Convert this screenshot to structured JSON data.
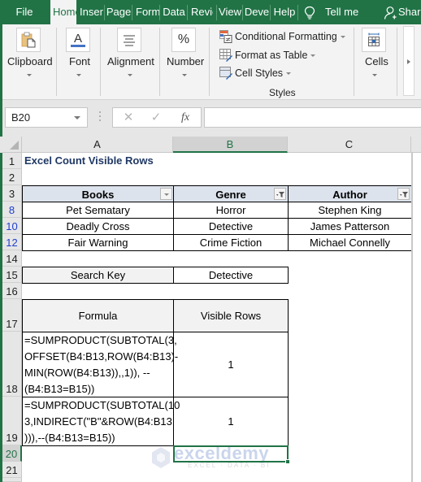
{
  "tabs": [
    {
      "label": "File",
      "active": false
    },
    {
      "label": "Home",
      "active": true
    },
    {
      "label": "Insert",
      "active": false
    },
    {
      "label": "Page",
      "active": false
    },
    {
      "label": "Form",
      "active": false
    },
    {
      "label": "Data",
      "active": false
    },
    {
      "label": "Revie",
      "active": false
    },
    {
      "label": "View",
      "active": false
    },
    {
      "label": "Deve",
      "active": false
    },
    {
      "label": "Help",
      "active": false
    }
  ],
  "tell_me": {
    "icon": "lightbulb-icon",
    "label": "Tell me"
  },
  "share": {
    "icon": "person-add-icon",
    "label": "Share"
  },
  "ribbon": {
    "groups": [
      {
        "label": "Clipboard",
        "icon": "clipboard-icon"
      },
      {
        "label": "Font",
        "icon": "font-icon"
      },
      {
        "label": "Alignment",
        "icon": "alignment-icon"
      },
      {
        "label": "Number",
        "icon": "percent-icon",
        "icon_text": "%"
      },
      {
        "label": "Cells",
        "icon": "cells-icon"
      }
    ],
    "styles": {
      "items": [
        {
          "label": "Conditional Formatting",
          "icon": "conditional-formatting-icon"
        },
        {
          "label": "Format as Table",
          "icon": "format-table-icon"
        },
        {
          "label": "Cell Styles",
          "icon": "cell-styles-icon"
        }
      ],
      "group_label": "Styles"
    },
    "font_letter": "A",
    "accent_underline_color": "#4472c4"
  },
  "formula_bar": {
    "name_box": "B20",
    "cancel_symbol": "✕",
    "enter_symbol": "✓",
    "fx_label": "fx",
    "value": ""
  },
  "columns": [
    "A",
    "B",
    "C"
  ],
  "selected_column": "B",
  "rows": [
    {
      "num": "1"
    },
    {
      "num": "2"
    },
    {
      "num": "3"
    },
    {
      "num": "8",
      "filtered": true
    },
    {
      "num": "10",
      "filtered": true
    },
    {
      "num": "12",
      "filtered": true
    },
    {
      "num": "14"
    },
    {
      "num": "15"
    },
    {
      "num": "16"
    },
    {
      "num": "17"
    },
    {
      "num": "18"
    },
    {
      "num": "19"
    },
    {
      "num": "20",
      "selected": true
    },
    {
      "num": "21"
    }
  ],
  "sheet": {
    "title": "Excel Count Visible Rows",
    "table": {
      "headers": [
        "Books",
        "Genre",
        "Author"
      ],
      "filter_state": [
        "dropdown",
        "filtered",
        "filtered"
      ],
      "rows": [
        [
          "Pet Sematary",
          "Horror",
          "Stephen King"
        ],
        [
          "Deadly Cross",
          "Detective",
          "James Patterson"
        ],
        [
          "Fair Warning",
          "Crime Fiction",
          "Michael Connelly"
        ]
      ]
    },
    "search_key": {
      "label": "Search Key",
      "value": "Detective"
    },
    "results": {
      "headers": [
        "Formula",
        "Visible Rows"
      ],
      "rows": [
        {
          "formula": "=SUMPRODUCT(SUBTOTAL(3,\nOFFSET(B4:B13,ROW(B4:B13)-\nMIN(ROW(B4:B13)),,1)), --\n(B4:B13=B15))",
          "value": "1"
        },
        {
          "formula": "=SUMPRODUCT(SUBTOTAL(10\n3,INDIRECT(\"B\"&ROW(B4:B13\n))),--(B4:B13=B15))",
          "value": "1"
        }
      ]
    }
  },
  "watermark": {
    "brand": "exceldemy",
    "tagline": "EXCEL · DATA · BI"
  },
  "colors": {
    "excel_green": "#217346",
    "title_text": "#1f3864",
    "table_header_fill": "#dde3ec",
    "filtered_row_number": "#1f3fcf"
  }
}
